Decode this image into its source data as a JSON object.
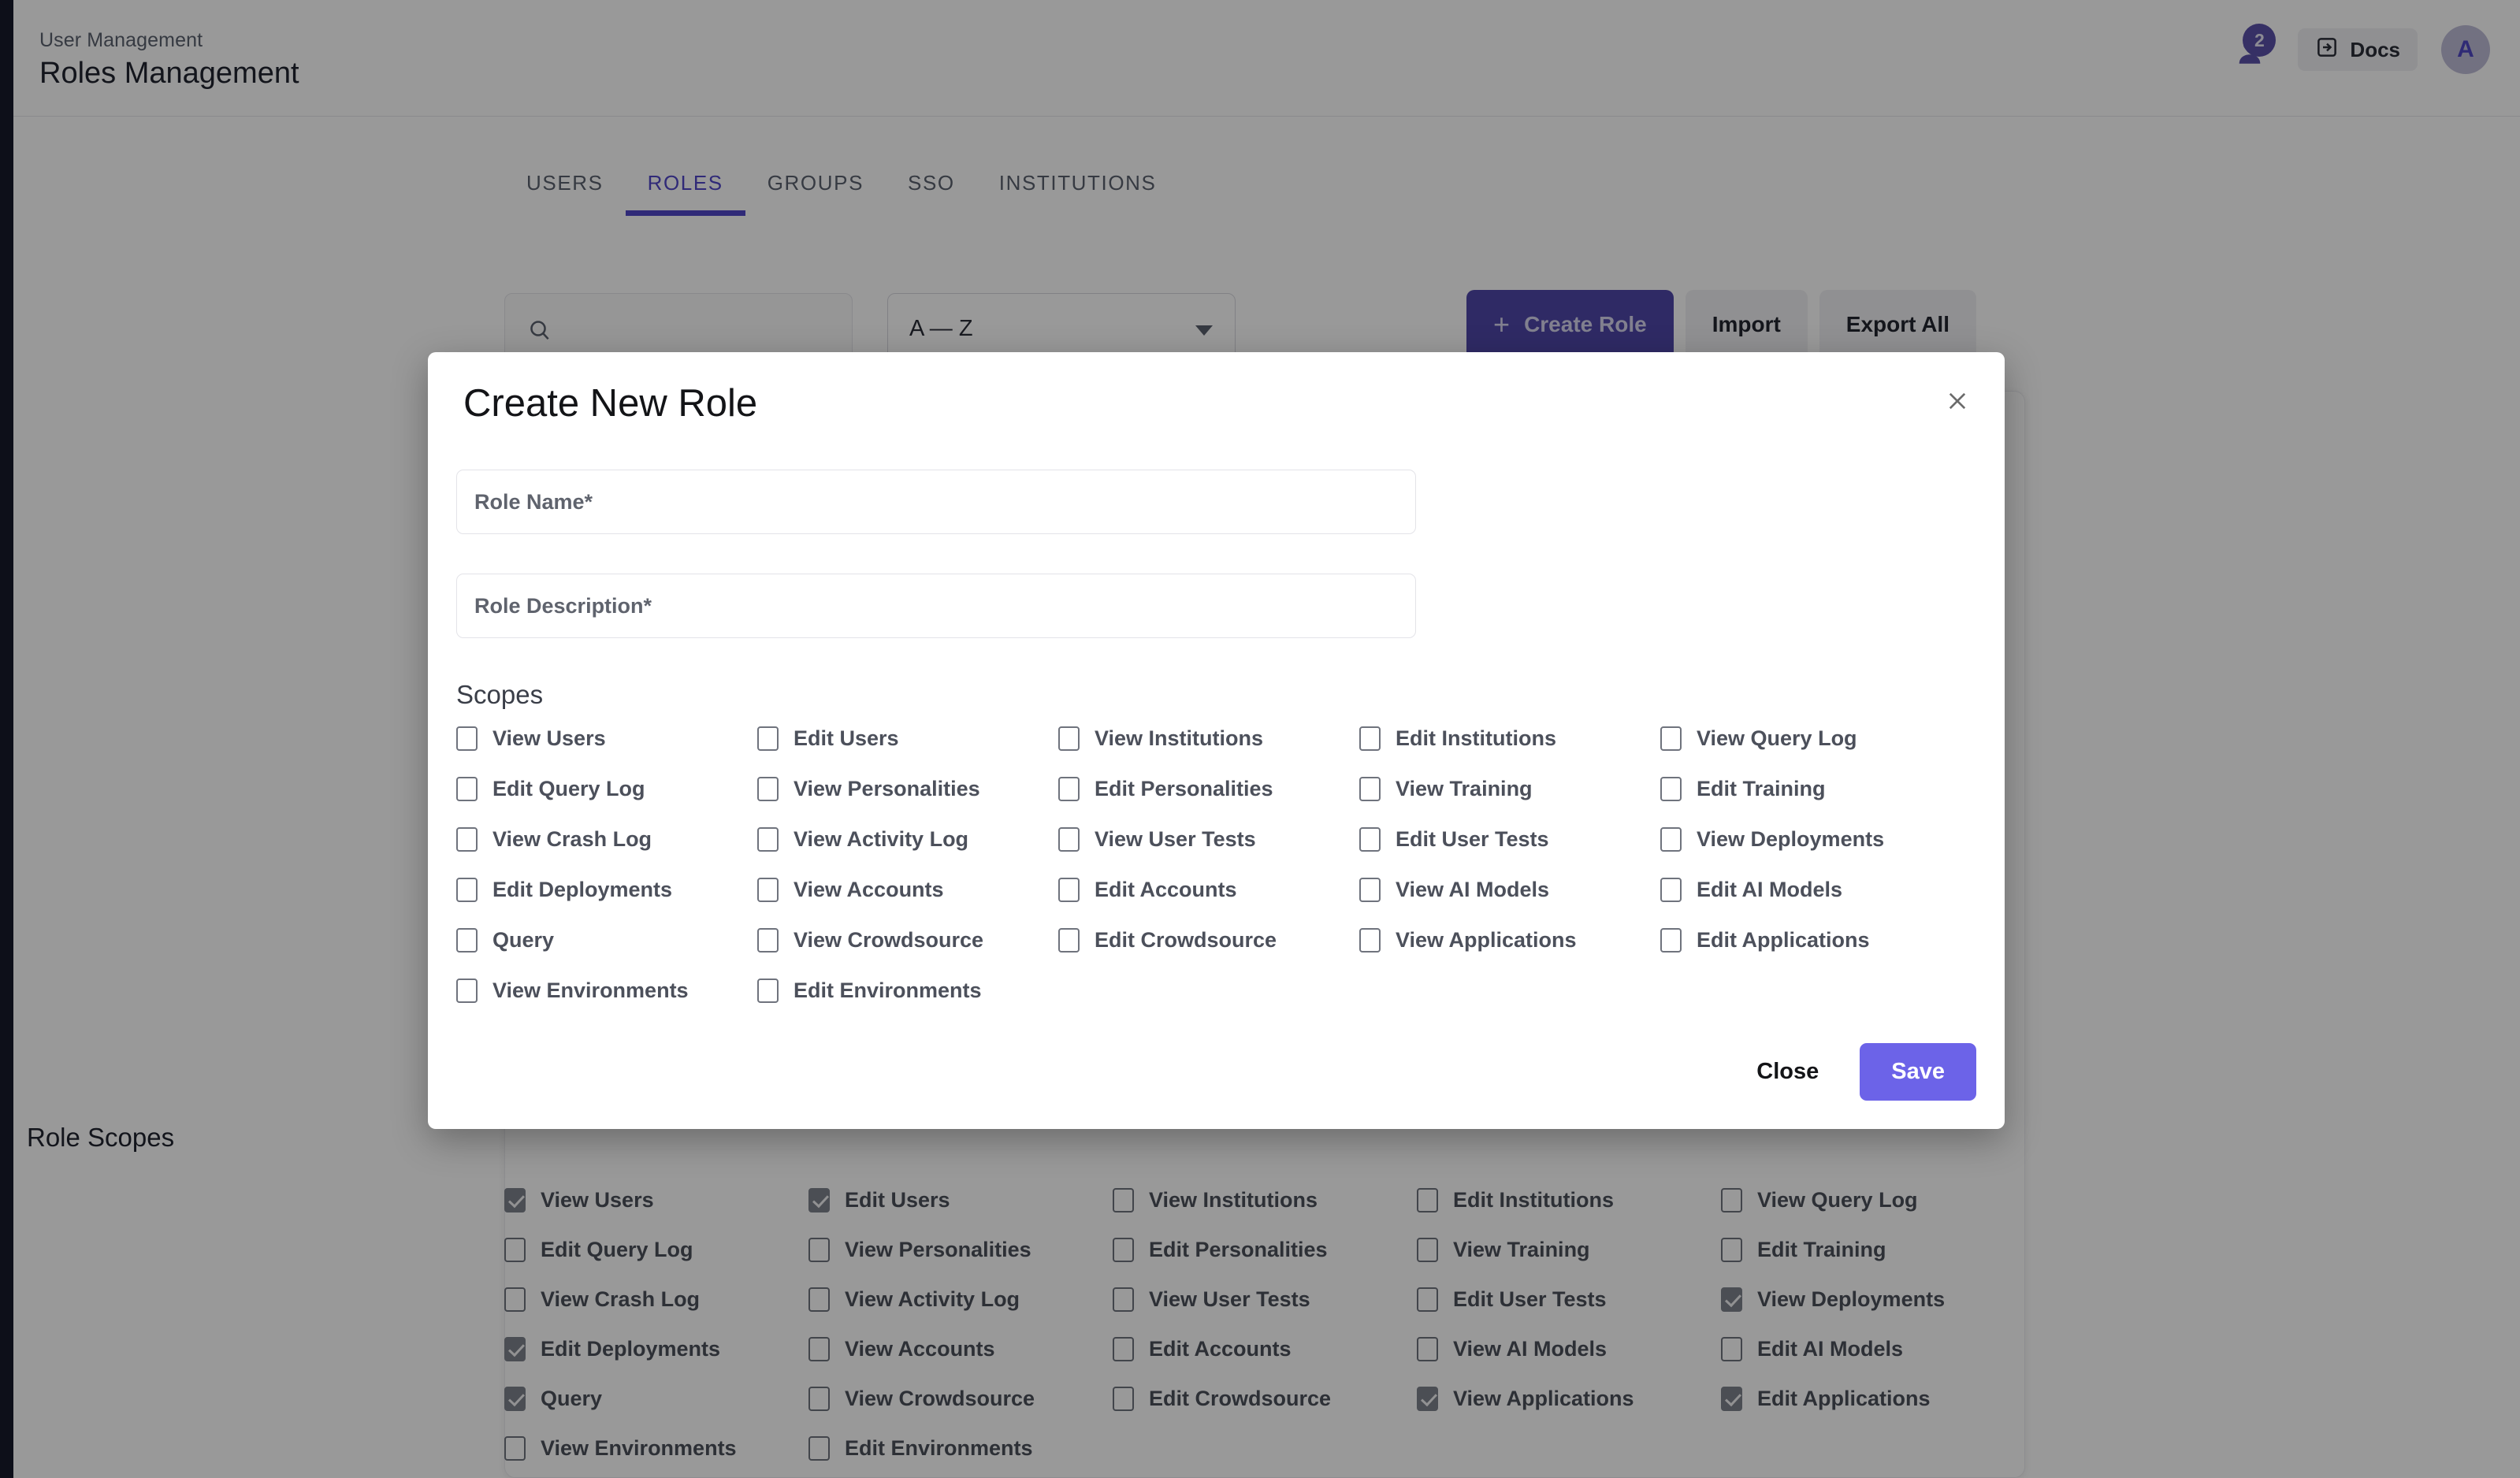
{
  "header": {
    "breadcrumb": "User Management",
    "title": "Roles Management",
    "notification_count": "2",
    "docs_label": "Docs",
    "avatar_initial": "A"
  },
  "tabs": [
    {
      "label": "USERS",
      "active": false
    },
    {
      "label": "ROLES",
      "active": true
    },
    {
      "label": "GROUPS",
      "active": false
    },
    {
      "label": "SSO",
      "active": false
    },
    {
      "label": "INSTITUTIONS",
      "active": false
    }
  ],
  "toolbar": {
    "search_value": "",
    "search_placeholder": "",
    "sort_value": "A — Z",
    "create_role_label": "Create Role",
    "create_role_plus": "+",
    "import_label": "Import",
    "export_all_label": "Export All"
  },
  "background_panel": {
    "title": "Role Scopes",
    "scopes": [
      {
        "label": "View Users",
        "checked": true
      },
      {
        "label": "Edit Users",
        "checked": true
      },
      {
        "label": "View Institutions",
        "checked": false
      },
      {
        "label": "Edit Institutions",
        "checked": false
      },
      {
        "label": "View Query Log",
        "checked": false
      },
      {
        "label": "Edit Query Log",
        "checked": false
      },
      {
        "label": "View Personalities",
        "checked": false
      },
      {
        "label": "Edit Personalities",
        "checked": false
      },
      {
        "label": "View Training",
        "checked": false
      },
      {
        "label": "Edit Training",
        "checked": false
      },
      {
        "label": "View Crash Log",
        "checked": false
      },
      {
        "label": "View Activity Log",
        "checked": false
      },
      {
        "label": "View User Tests",
        "checked": false
      },
      {
        "label": "Edit User Tests",
        "checked": false
      },
      {
        "label": "View Deployments",
        "checked": true
      },
      {
        "label": "Edit Deployments",
        "checked": true
      },
      {
        "label": "View Accounts",
        "checked": false
      },
      {
        "label": "Edit Accounts",
        "checked": false
      },
      {
        "label": "View AI Models",
        "checked": false
      },
      {
        "label": "Edit AI Models",
        "checked": false
      },
      {
        "label": "Query",
        "checked": true
      },
      {
        "label": "View Crowdsource",
        "checked": false
      },
      {
        "label": "Edit Crowdsource",
        "checked": false
      },
      {
        "label": "View Applications",
        "checked": true
      },
      {
        "label": "Edit Applications",
        "checked": true
      },
      {
        "label": "View Environments",
        "checked": false
      },
      {
        "label": "Edit Environments",
        "checked": false
      }
    ]
  },
  "modal": {
    "title": "Create New Role",
    "close_icon": "close-icon",
    "role_name_value": "",
    "role_name_placeholder": "Role Name*",
    "role_description_value": "",
    "role_description_placeholder": "Role Description*",
    "scopes_label": "Scopes",
    "scopes": [
      {
        "label": "View Users",
        "checked": false
      },
      {
        "label": "Edit Users",
        "checked": false
      },
      {
        "label": "View Institutions",
        "checked": false
      },
      {
        "label": "Edit Institutions",
        "checked": false
      },
      {
        "label": "View Query Log",
        "checked": false
      },
      {
        "label": "Edit Query Log",
        "checked": false
      },
      {
        "label": "View Personalities",
        "checked": false
      },
      {
        "label": "Edit Personalities",
        "checked": false
      },
      {
        "label": "View Training",
        "checked": false
      },
      {
        "label": "Edit Training",
        "checked": false
      },
      {
        "label": "View Crash Log",
        "checked": false
      },
      {
        "label": "View Activity Log",
        "checked": false
      },
      {
        "label": "View User Tests",
        "checked": false
      },
      {
        "label": "Edit User Tests",
        "checked": false
      },
      {
        "label": "View Deployments",
        "checked": false
      },
      {
        "label": "Edit Deployments",
        "checked": false
      },
      {
        "label": "View Accounts",
        "checked": false
      },
      {
        "label": "Edit Accounts",
        "checked": false
      },
      {
        "label": "View AI Models",
        "checked": false
      },
      {
        "label": "Edit AI Models",
        "checked": false
      },
      {
        "label": "Query",
        "checked": false
      },
      {
        "label": "View Crowdsource",
        "checked": false
      },
      {
        "label": "Edit Crowdsource",
        "checked": false
      },
      {
        "label": "View Applications",
        "checked": false
      },
      {
        "label": "Edit Applications",
        "checked": false
      },
      {
        "label": "View Environments",
        "checked": false
      },
      {
        "label": "Edit Environments",
        "checked": false
      }
    ],
    "close_label": "Close",
    "save_label": "Save"
  },
  "colors": {
    "accent": "#5046c8",
    "primary_button": "#4f46a8",
    "save_button": "#6c63e8",
    "badge": "#5a51a8",
    "rail": "#171a2b"
  }
}
